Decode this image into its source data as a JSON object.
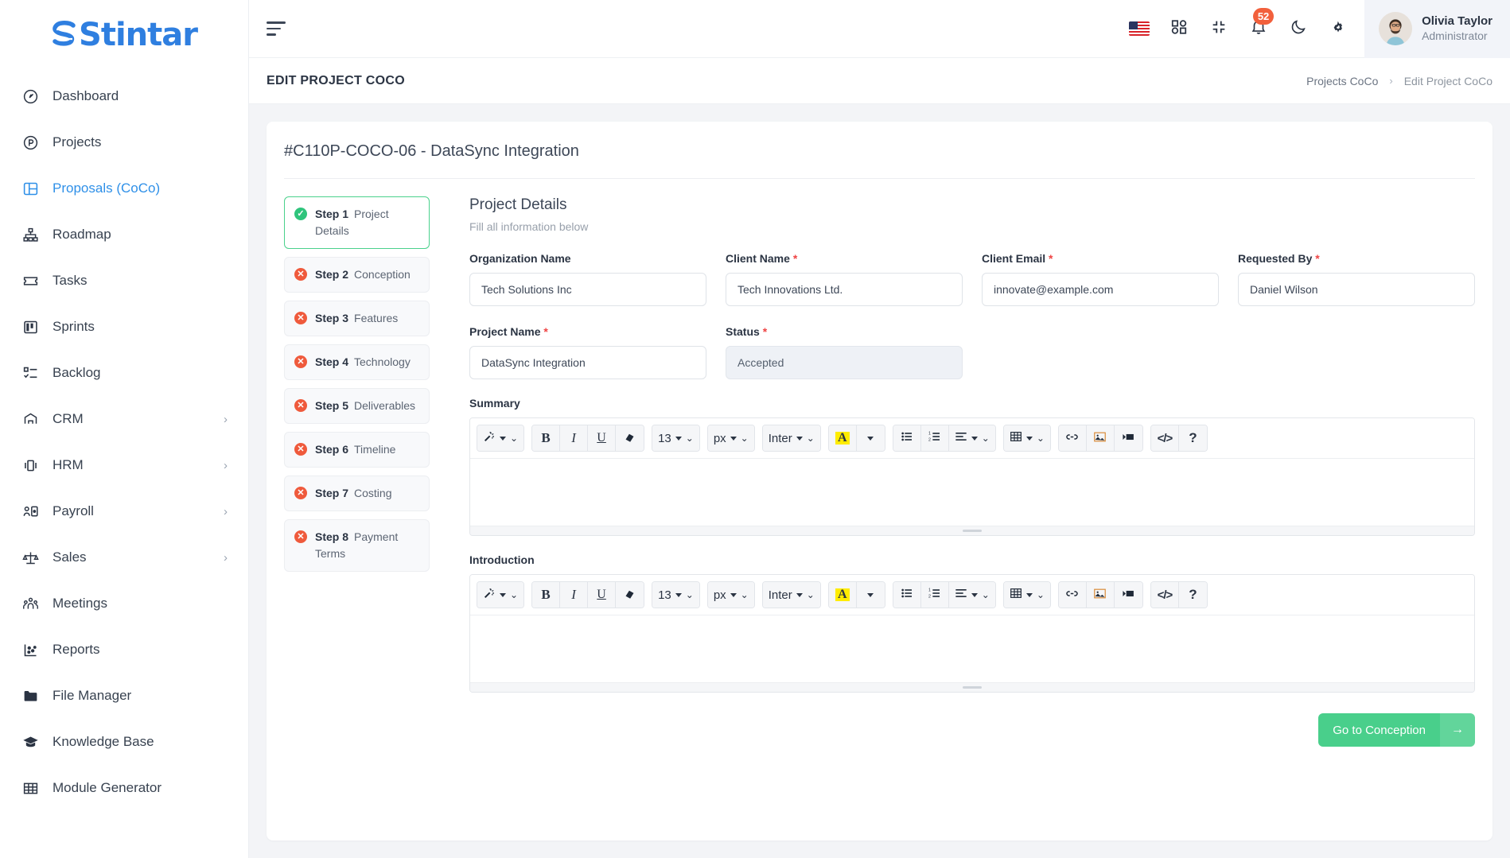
{
  "brand": {
    "name": "Stintar",
    "color": "#2f7fe0",
    "accent_green": "#49cf8b"
  },
  "sidebar": {
    "items": [
      {
        "label": "Dashboard",
        "icon": "gauge-icon",
        "has_submenu": false,
        "active": false
      },
      {
        "label": "Projects",
        "icon": "circle-p-icon",
        "has_submenu": false,
        "active": false
      },
      {
        "label": "Proposals (CoCo)",
        "icon": "layout-panel-icon",
        "has_submenu": false,
        "active": true
      },
      {
        "label": "Roadmap",
        "icon": "hierarchy-icon",
        "has_submenu": false,
        "active": false
      },
      {
        "label": "Tasks",
        "icon": "ticket-icon",
        "has_submenu": false,
        "active": false
      },
      {
        "label": "Sprints",
        "icon": "board-icon",
        "has_submenu": false,
        "active": false
      },
      {
        "label": "Backlog",
        "icon": "checklist-icon",
        "has_submenu": false,
        "active": false
      },
      {
        "label": "CRM",
        "icon": "handshake-icon",
        "has_submenu": true,
        "active": false
      },
      {
        "label": "HRM",
        "icon": "badge-icon",
        "has_submenu": true,
        "active": false
      },
      {
        "label": "Payroll",
        "icon": "user-card-icon",
        "has_submenu": true,
        "active": false
      },
      {
        "label": "Sales",
        "icon": "scales-icon",
        "has_submenu": true,
        "active": false
      },
      {
        "label": "Meetings",
        "icon": "people-icon",
        "has_submenu": false,
        "active": false
      },
      {
        "label": "Reports",
        "icon": "scatter-chart-icon",
        "has_submenu": false,
        "active": false
      },
      {
        "label": "File Manager",
        "icon": "folder-icon",
        "has_submenu": false,
        "active": false
      },
      {
        "label": "Knowledge Base",
        "icon": "graduation-cap-icon",
        "has_submenu": false,
        "active": false
      },
      {
        "label": "Module Generator",
        "icon": "grid-table-icon",
        "has_submenu": false,
        "active": false
      }
    ],
    "chevron": "›"
  },
  "topbar": {
    "menu_toggle": "hamburger-icon",
    "language_flag": "us-flag-icon",
    "apps_icon": "apps-grid-icon",
    "fullscreen_icon": "collapse-screen-icon",
    "notifications_icon": "bell-icon",
    "notifications_count": "52",
    "theme_icon": "moon-icon",
    "settings_icon": "gear-icon",
    "user": {
      "name": "Olivia Taylor",
      "role": "Administrator"
    }
  },
  "pagehead": {
    "title": "EDIT PROJECT COCO",
    "breadcrumb": {
      "parent": "Projects CoCo",
      "separator": "›",
      "current": "Edit Project CoCo"
    }
  },
  "card": {
    "title": "#C110P-COCO-06 - DataSync Integration"
  },
  "steps": [
    {
      "num": "Step 1",
      "label": "Project Details",
      "state": "ok",
      "active": true
    },
    {
      "num": "Step 2",
      "label": "Conception",
      "state": "no",
      "active": false
    },
    {
      "num": "Step 3",
      "label": "Features",
      "state": "no",
      "active": false
    },
    {
      "num": "Step 4",
      "label": "Technology",
      "state": "no",
      "active": false
    },
    {
      "num": "Step 5",
      "label": "Deliverables",
      "state": "no",
      "active": false
    },
    {
      "num": "Step 6",
      "label": "Timeline",
      "state": "no",
      "active": false
    },
    {
      "num": "Step 7",
      "label": "Costing",
      "state": "no",
      "active": false
    },
    {
      "num": "Step 8",
      "label": "Payment Terms",
      "state": "no",
      "active": false
    }
  ],
  "form": {
    "section_title": "Project Details",
    "section_subtitle": "Fill all information below",
    "fields": {
      "organization_name": {
        "label": "Organization Name",
        "required": false,
        "value": "Tech Solutions Inc"
      },
      "client_name": {
        "label": "Client Name",
        "required": true,
        "value": "Tech Innovations Ltd."
      },
      "client_email": {
        "label": "Client Email",
        "required": true,
        "value": "innovate@example.com"
      },
      "requested_by": {
        "label": "Requested By",
        "required": true,
        "value": "Daniel Wilson"
      },
      "project_name": {
        "label": "Project Name",
        "required": true,
        "value": "DataSync Integration"
      },
      "status": {
        "label": "Status",
        "required": true,
        "value": "Accepted"
      }
    },
    "required_mark": "*",
    "summary": {
      "label": "Summary",
      "value": ""
    },
    "introduction": {
      "label": "Introduction",
      "value": ""
    },
    "next_button": {
      "label": "Go to Conception",
      "arrow": "→"
    }
  },
  "editor_toolbar": {
    "style_icon": "magic-wand-icon",
    "bold": "B",
    "italic": "I",
    "underline": "U",
    "clear_format_icon": "eraser-icon",
    "font_size": "13",
    "font_unit": "px",
    "font_family": "Inter",
    "text_color": "A",
    "bullet_list_icon": "bullet-list-icon",
    "numbered_list_icon": "numbered-list-icon",
    "align_icon": "align-left-icon",
    "table_icon": "table-icon",
    "link_icon": "link-icon",
    "image_icon": "image-icon",
    "video_icon": "video-icon",
    "code_view": "</>",
    "help": "?"
  }
}
